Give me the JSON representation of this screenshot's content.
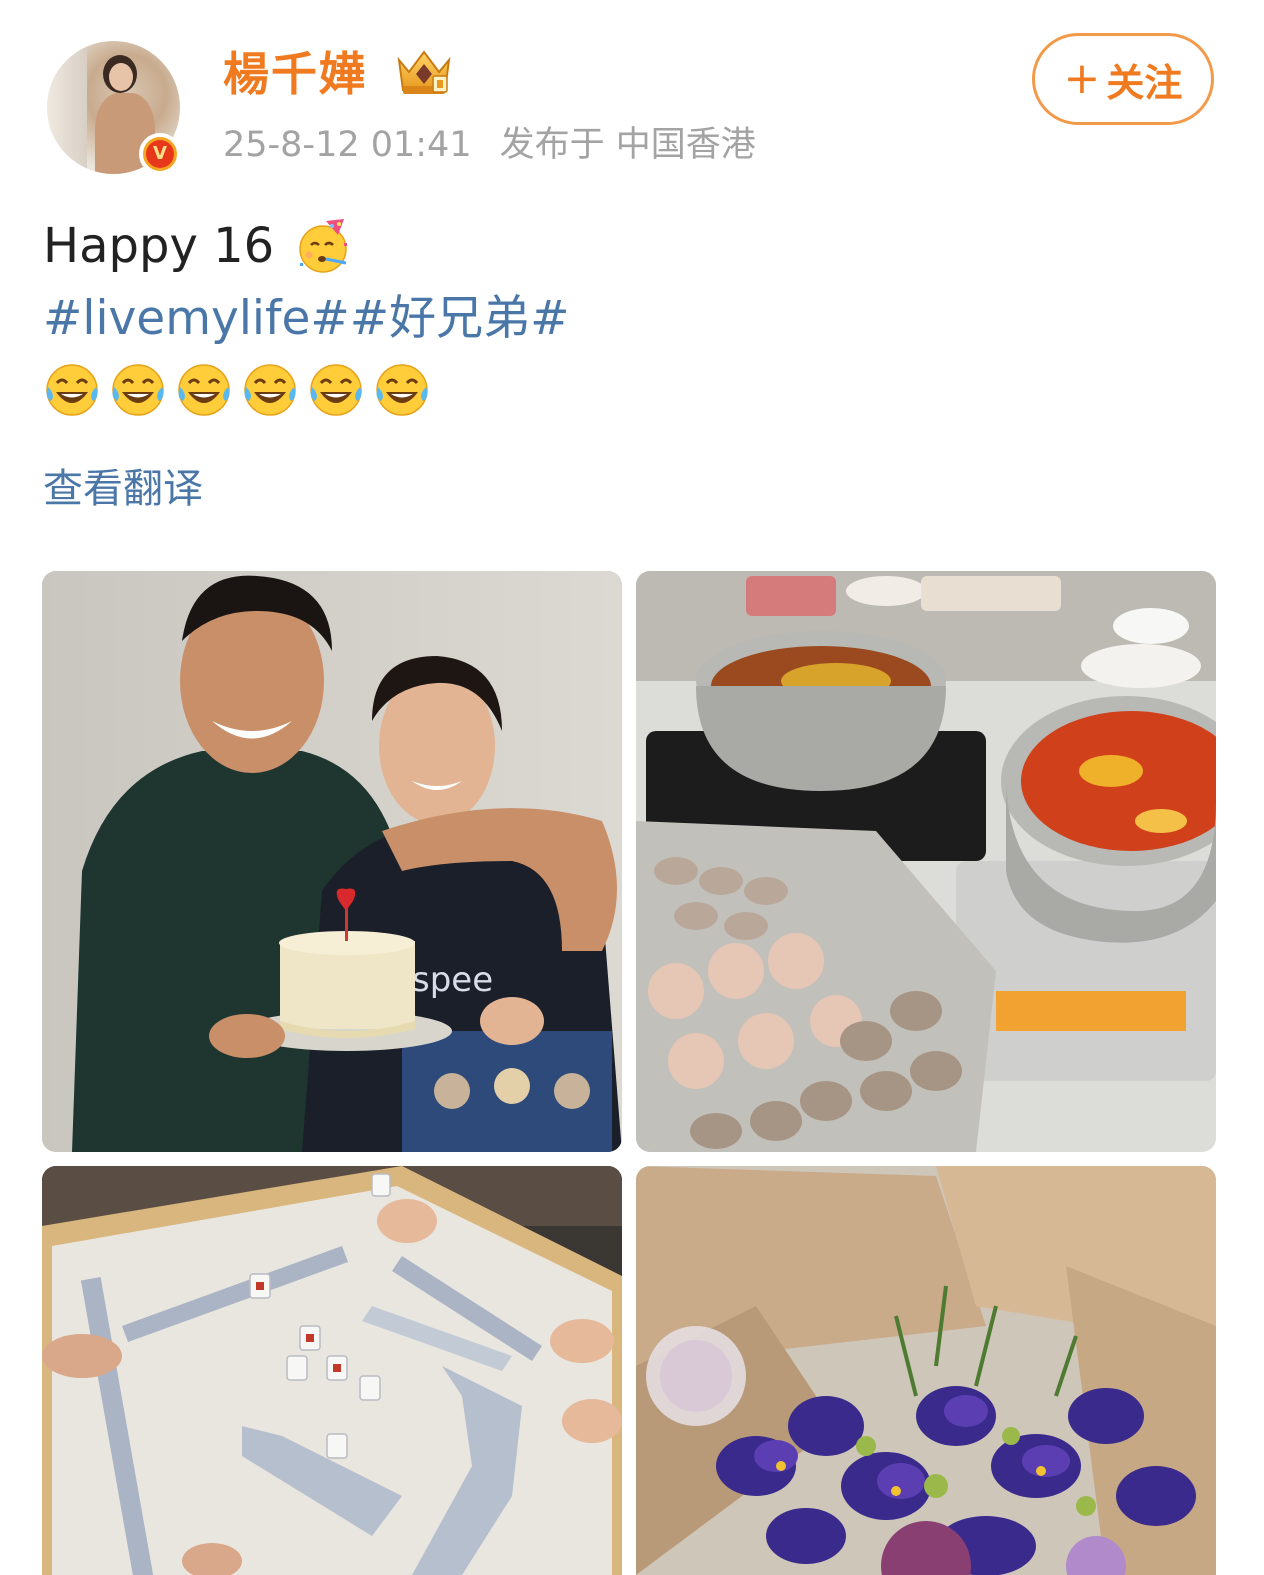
{
  "user": {
    "name": "楊千嬅",
    "timestamp": "25-8-12 01:41",
    "location": "发布于 中国香港",
    "verified": true
  },
  "follow_button": {
    "label": "关注"
  },
  "post": {
    "text": "Happy 16",
    "hashtags": "#livemylife##好兄弟#",
    "laugh_emoji_count": 6,
    "translate_label": "查看翻译"
  },
  "photos": [
    {
      "subject": "couple-with-birthday-cake"
    },
    {
      "subject": "hotpot-and-seafood"
    },
    {
      "subject": "mahjong-table"
    },
    {
      "subject": "purple-flower-bouquet"
    }
  ],
  "colors": {
    "username": "#f07a20",
    "link": "#4a77a8",
    "meta": "#a3a3a3",
    "follow_border": "#f39a4a"
  }
}
